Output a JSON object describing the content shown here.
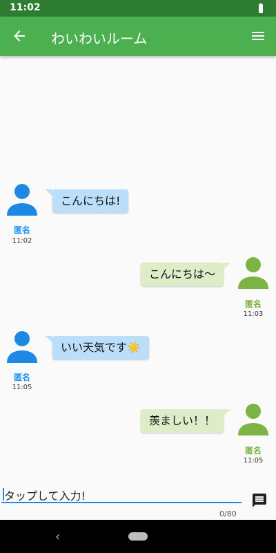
{
  "status_bar": {
    "time": "11:02"
  },
  "app_bar": {
    "title": "わいわいルーム"
  },
  "messages": [
    {
      "side": "left",
      "text": "こんにちは!",
      "sender": "匿名",
      "time": "11:02"
    },
    {
      "side": "right",
      "text": "こんにちは〜",
      "sender": "匿名",
      "time": "11:03"
    },
    {
      "side": "left",
      "text": "いい天気です☀️",
      "sender": "匿名",
      "time": "11:05"
    },
    {
      "side": "right",
      "text": "羨ましい！！",
      "sender": "匿名",
      "time": "11:05"
    }
  ],
  "input": {
    "placeholder": "タップして入力!",
    "counter": "0/80"
  },
  "colors": {
    "primary": "#4caf50",
    "primary_dark": "#2e7d32",
    "left_bubble": "#bbdefb",
    "right_bubble": "#dcedc8",
    "left_name": "#2196f3",
    "right_name": "#7cb342"
  },
  "icons": {
    "back": "arrow-left-icon",
    "menu": "hamburger-menu-icon",
    "battery": "battery-icon",
    "send": "message-icon",
    "avatar": "person-icon"
  }
}
